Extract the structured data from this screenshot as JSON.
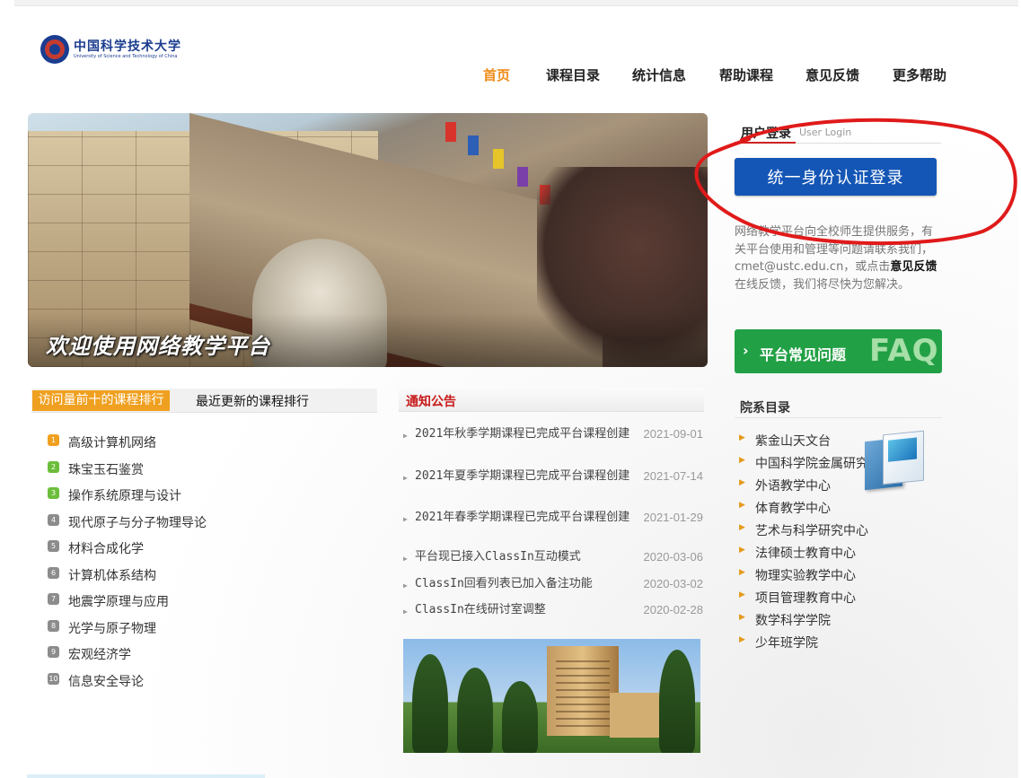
{
  "logo": {
    "cn": "中国科学技术大学",
    "en": "University of Science and Technology of China",
    "seal_icon": "ustc-seal-icon"
  },
  "nav": {
    "items": [
      "首页",
      "课程目录",
      "统计信息",
      "帮助课程",
      "意见反馈",
      "更多帮助"
    ],
    "active": "首页",
    "active_color": "#f08c1a"
  },
  "banner": {
    "title": "欢迎使用网络教学平台"
  },
  "login": {
    "tab_cn": "用户登录",
    "tab_en": "User Login",
    "button": "统一身份认证登录",
    "button_color": "#1456b6",
    "desc_before": "网络教学平台向全校师生提供服务，有关平台使用和管理等问题请联系我们，cmet@ustc.edu.cn，或点击",
    "desc_link": "意见反馈",
    "desc_after": "在线反馈，我们将尽快为您解决。",
    "annotation_color": "#e01a1a"
  },
  "faq": {
    "label": "平台常见问题",
    "big": "FAQ",
    "arrow_icon": "chevron-right-icon",
    "color": "#22a045"
  },
  "departments": {
    "title": "院系目录",
    "items": [
      "紫金山天文台",
      "中国科学院金属研究所",
      "外语教学中心",
      "体育教学中心",
      "艺术与科学研究中心",
      "法律硕士教育中心",
      "物理实验教学中心",
      "项目管理教育中心",
      "数学科学学院",
      "少年班学院"
    ]
  },
  "ranking": {
    "tab_active": "访问量前十的课程排行",
    "tab_other": "最近更新的课程排行",
    "items": [
      {
        "num": "1",
        "name": "高级计算机网络"
      },
      {
        "num": "2",
        "name": "珠宝玉石鉴赏"
      },
      {
        "num": "3",
        "name": "操作系统原理与设计"
      },
      {
        "num": "4",
        "name": "现代原子与分子物理导论"
      },
      {
        "num": "5",
        "name": "材料合成化学"
      },
      {
        "num": "6",
        "name": "计算机体系结构"
      },
      {
        "num": "7",
        "name": "地震学原理与应用"
      },
      {
        "num": "8",
        "name": "光学与原子物理"
      },
      {
        "num": "9",
        "name": "宏观经济学"
      },
      {
        "num": "10",
        "name": "信息安全导论"
      }
    ]
  },
  "notices": {
    "title": "通知公告",
    "items": [
      {
        "text": "2021年秋季学期课程已完成平台课程创建",
        "date": "2021-09-01"
      },
      {
        "text": "2021年夏季学期课程已完成平台课程创建",
        "date": "2021-07-14"
      },
      {
        "text": "2021年春季学期课程已完成平台课程创建",
        "date": "2021-01-29"
      },
      {
        "text": "平台现已接入ClassIn互动模式",
        "date": "2020-03-06"
      },
      {
        "text": "ClassIn回看列表已加入备注功能",
        "date": "2020-03-02"
      },
      {
        "text": "ClassIn在线研讨室调整",
        "date": "2020-02-28"
      }
    ]
  }
}
